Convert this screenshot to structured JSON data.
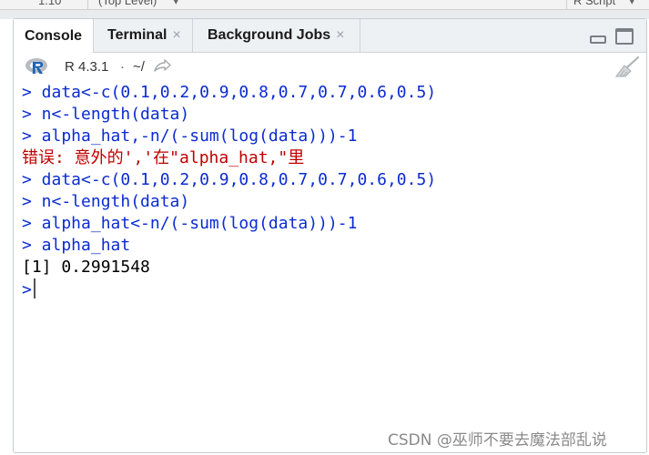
{
  "editor_status": {
    "position": "1:10",
    "scope": "(Top Level)",
    "file_type": "R Script"
  },
  "tabs": [
    {
      "label": "Console",
      "active": true
    },
    {
      "label": "Terminal",
      "active": false
    },
    {
      "label": "Background Jobs",
      "active": false
    }
  ],
  "info": {
    "r_version": "R 4.3.1",
    "separator": "·",
    "working_dir": "~/"
  },
  "console": {
    "prompt": ">",
    "lines": [
      {
        "type": "input",
        "text": "> data<-c(0.1,0.2,0.9,0.8,0.7,0.7,0.6,0.5)"
      },
      {
        "type": "input",
        "text": "> n<-length(data)"
      },
      {
        "type": "input",
        "text": "> alpha_hat,-n/(-sum(log(data)))-1"
      },
      {
        "type": "error",
        "text": "错误: 意外的','在\"alpha_hat,\"里"
      },
      {
        "type": "input",
        "text": "> data<-c(0.1,0.2,0.9,0.8,0.7,0.7,0.6,0.5)"
      },
      {
        "type": "input",
        "text": "> n<-length(data)"
      },
      {
        "type": "input",
        "text": "> alpha_hat<-n/(-sum(log(data)))-1"
      },
      {
        "type": "input",
        "text": "> alpha_hat"
      },
      {
        "type": "output",
        "text": "[1] 0.2991548"
      }
    ]
  },
  "watermark": "CSDN @巫师不要去魔法部乱说",
  "colors": {
    "input": "#0b2bd1",
    "error": "#c00000",
    "output": "#000000",
    "r_logo_blue": "#2165b6"
  },
  "icons": {
    "tab_close": "close-icon",
    "minimize": "minimize-icon",
    "maximize": "maximize-icon",
    "r_logo": "r-logo-icon",
    "go_to_dir": "go-to-directory-icon",
    "clear": "broom-icon"
  }
}
